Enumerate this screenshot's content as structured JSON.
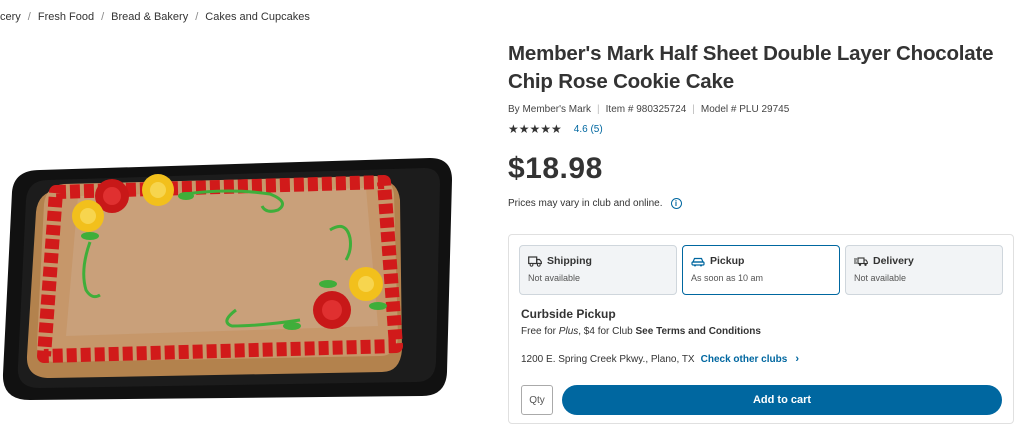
{
  "breadcrumb": [
    "cery",
    "Fresh Food",
    "Bread & Bakery",
    "Cakes and Cupcakes"
  ],
  "product": {
    "title_line1": "Member's Mark Half Sheet Double Layer Chocolate",
    "title_line2": "Chip Rose Cookie Cake",
    "brand": "By Member's Mark",
    "item": "Item # 980325724",
    "model": "Model # PLU 29745",
    "stars": "★★★★★",
    "rating_link": "4.6 (5)",
    "rating_value": 4.6,
    "price": "$18.98",
    "price_note": "Prices may vary in club and online."
  },
  "fulfillment": {
    "options": [
      {
        "label": "Shipping",
        "sub": "Not available",
        "icon": "truck-icon"
      },
      {
        "label": "Pickup",
        "sub": "As soon as 10 am",
        "icon": "pickup-car-icon",
        "selected": true
      },
      {
        "label": "Delivery",
        "sub": "Not available",
        "icon": "delivery-icon"
      }
    ],
    "pickup_title": "Curbside Pickup",
    "pickup_desc_prefix": "Free for ",
    "pickup_desc_plus": "Plus",
    "pickup_desc_mid": ", $4 for Club ",
    "pickup_desc_link": "See Terms and Conditions",
    "club_address": "1200 E. Spring Creek Pkwy., Plano, TX",
    "club_link": "Check other clubs",
    "qty_placeholder": "Qty",
    "add_to_cart": "Add to cart"
  },
  "colors": {
    "accent": "#0067a0"
  }
}
